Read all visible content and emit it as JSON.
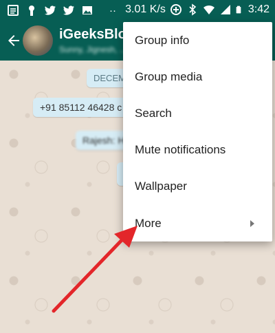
{
  "status_bar": {
    "speed": "3.01 K/s",
    "time": "3:42",
    "dots": "··",
    "left_icons": [
      "notes-icon",
      "keyhole-icon",
      "twitter-icon",
      "twitter-icon",
      "image-icon"
    ],
    "right_icons": [
      "data-saver-icon",
      "bluetooth-icon",
      "wifi-icon",
      "signal-icon",
      "battery-icon"
    ]
  },
  "header": {
    "title": "iGeeksBlog",
    "subtitle": "Sunny, Jignesh, ..."
  },
  "chat": {
    "date_chip": "DECEM",
    "messages": [
      {
        "text": "+91 85112 46428 c"
      },
      {
        "text": "Rajesh: Hi..."
      }
    ]
  },
  "menu": {
    "items": [
      {
        "label": "Group info"
      },
      {
        "label": "Group media"
      },
      {
        "label": "Search"
      },
      {
        "label": "Mute notifications"
      },
      {
        "label": "Wallpaper"
      },
      {
        "label": "More",
        "has_submenu": true
      }
    ]
  },
  "annotation": {
    "type": "arrow",
    "color": "#e3262a",
    "points_to": "More"
  },
  "colors": {
    "header": "#075e54",
    "menu_background": "#ffffff",
    "bubble": "#d6ecf5",
    "chat_background": "#e9dfd4"
  }
}
